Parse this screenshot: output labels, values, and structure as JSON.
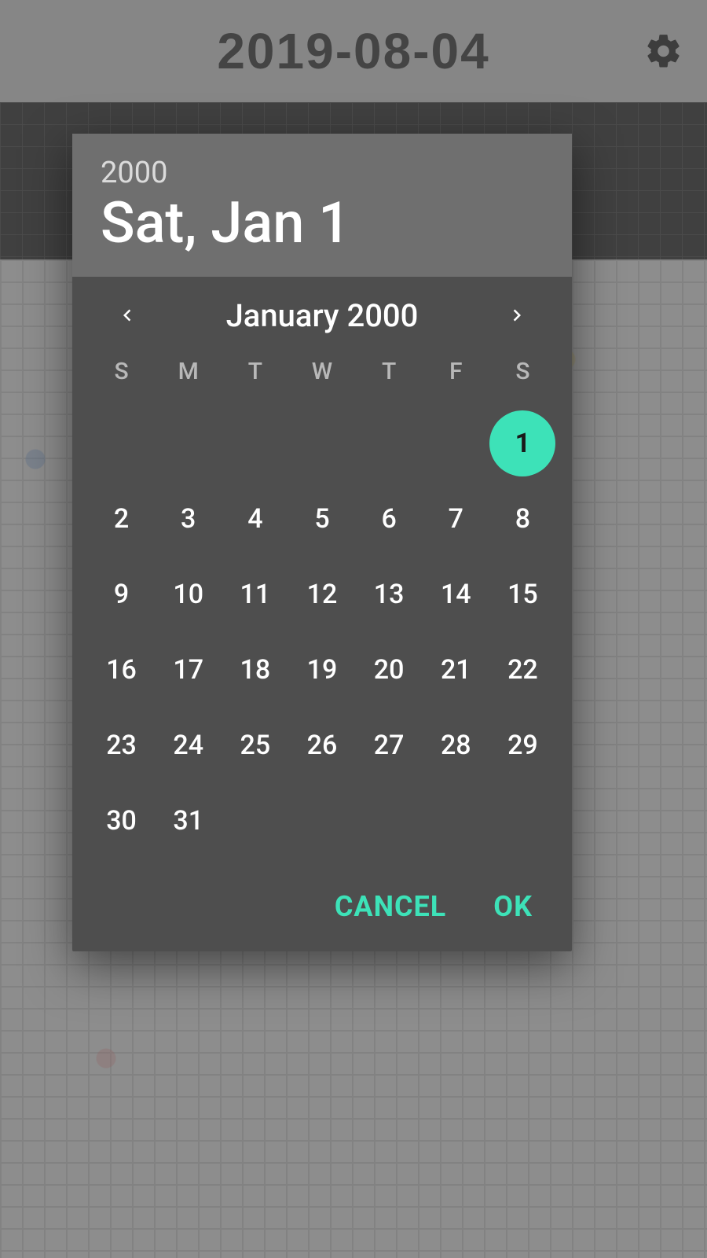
{
  "background": {
    "title": "2019-08-04",
    "gear_icon": "settings"
  },
  "dialog": {
    "header": {
      "year": "2000",
      "date_display": "Sat, Jan 1"
    },
    "month_nav": {
      "label": "January 2000"
    },
    "dow": [
      "S",
      "M",
      "T",
      "W",
      "T",
      "F",
      "S"
    ],
    "leading_blanks": 6,
    "days_in_month": 31,
    "selected_day": 1,
    "actions": {
      "cancel": "CANCEL",
      "ok": "OK"
    }
  },
  "colors": {
    "accent": "#3de2b8"
  }
}
